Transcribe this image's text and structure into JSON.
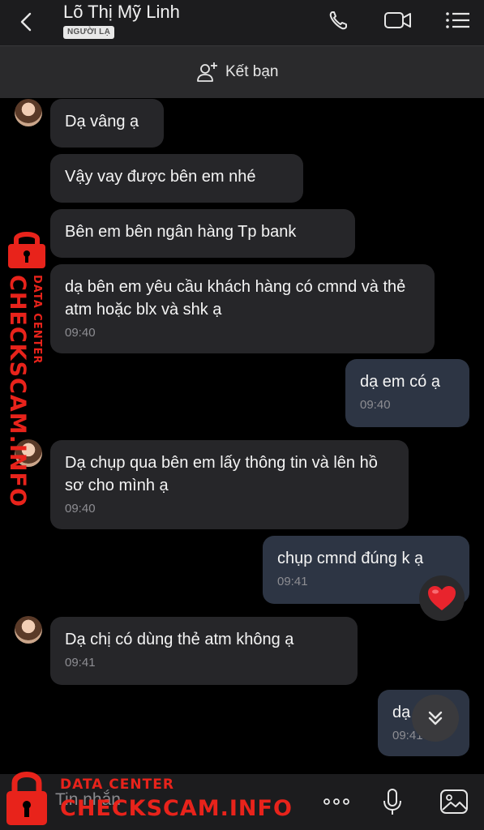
{
  "header": {
    "contact_name": "Lõ Thị Mỹ Linh",
    "badge": "NGƯỜI LẠ",
    "icons": [
      "back-chevron-icon",
      "phone-icon",
      "video-icon",
      "menu-list-icon"
    ]
  },
  "add_friend": {
    "label": "Kết bạn",
    "icon": "add-person-icon"
  },
  "messages": [
    {
      "direction": "in",
      "text": "Dạ vâng ạ",
      "time": ""
    },
    {
      "direction": "in",
      "text": "Vậy vay được bên em nhé",
      "time": ""
    },
    {
      "direction": "in",
      "text": "Bên em bên ngân hàng Tp bank",
      "time": ""
    },
    {
      "direction": "in",
      "text": "dạ bên em yêu cầu khách hàng có cmnd và thẻ atm hoặc blx và shk ạ",
      "time": "09:40"
    },
    {
      "direction": "out",
      "text": "dạ em có ạ",
      "time": "09:40"
    },
    {
      "direction": "in",
      "text": " Dạ chụp qua bên em lấy thông tin và lên hồ sơ cho mình ạ",
      "time": "09:40"
    },
    {
      "direction": "out",
      "text": "chụp cmnd đúng k ạ",
      "time": "09:41",
      "reaction": "heart"
    },
    {
      "direction": "in",
      "text": "Dạ chị có dùng thẻ atm không ạ",
      "time": "09:41"
    },
    {
      "direction": "out",
      "text": "dạ",
      "time": "09:41"
    }
  ],
  "composer": {
    "placeholder": "Tin nhắn",
    "icons": [
      "more-dots-icon",
      "microphone-icon",
      "image-icon"
    ]
  },
  "watermark": {
    "small": "DATA CENTER",
    "big": "CHECKSCAM.INFO",
    "color": "#e8231b"
  },
  "colors": {
    "incoming_bubble": "#262629",
    "outgoing_bubble": "#2d3544",
    "background": "#000000"
  }
}
